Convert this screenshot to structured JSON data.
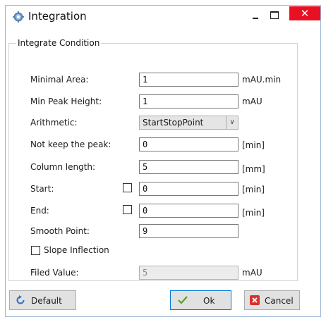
{
  "window": {
    "title": "Integration",
    "close_glyph": "✕"
  },
  "group": {
    "legend": "Integrate Condition"
  },
  "rows": {
    "minimal_area": {
      "label": "Minimal Area:",
      "value": "1",
      "unit": "mAU.min"
    },
    "min_peak_height": {
      "label": "Min Peak Height:",
      "value": "1",
      "unit": "mAU"
    },
    "arithmetic": {
      "label": "Arithmetic:",
      "value": "StartStopPoint"
    },
    "not_keep_peak": {
      "label": "Not keep the peak:",
      "value": "0",
      "unit": "[min]"
    },
    "column_length": {
      "label": "Column length:",
      "value": "5",
      "unit": "[mm]"
    },
    "start": {
      "label": "Start:",
      "value": "0",
      "unit": "[min]",
      "checked": false
    },
    "end": {
      "label": "End:",
      "value": "0",
      "unit": "[min]",
      "checked": false
    },
    "smooth_point": {
      "label": "Smooth Point:",
      "value": "9"
    },
    "slope_inflection": {
      "label": "Slope Inflection",
      "checked": false
    },
    "filed_value": {
      "label": "Filed Value:",
      "value": "5",
      "unit": "mAU"
    }
  },
  "buttons": {
    "default": "Default",
    "ok": "Ok",
    "cancel": "Cancel"
  },
  "colors": {
    "close_red": "#e81123",
    "ok_check": "#5aa02c",
    "cancel_red": "#d9302c",
    "default_blue": "#2f6fc2"
  },
  "icons": {
    "app": "gear-icon",
    "default": "refresh-icon",
    "ok": "check-icon",
    "cancel": "close-icon"
  }
}
